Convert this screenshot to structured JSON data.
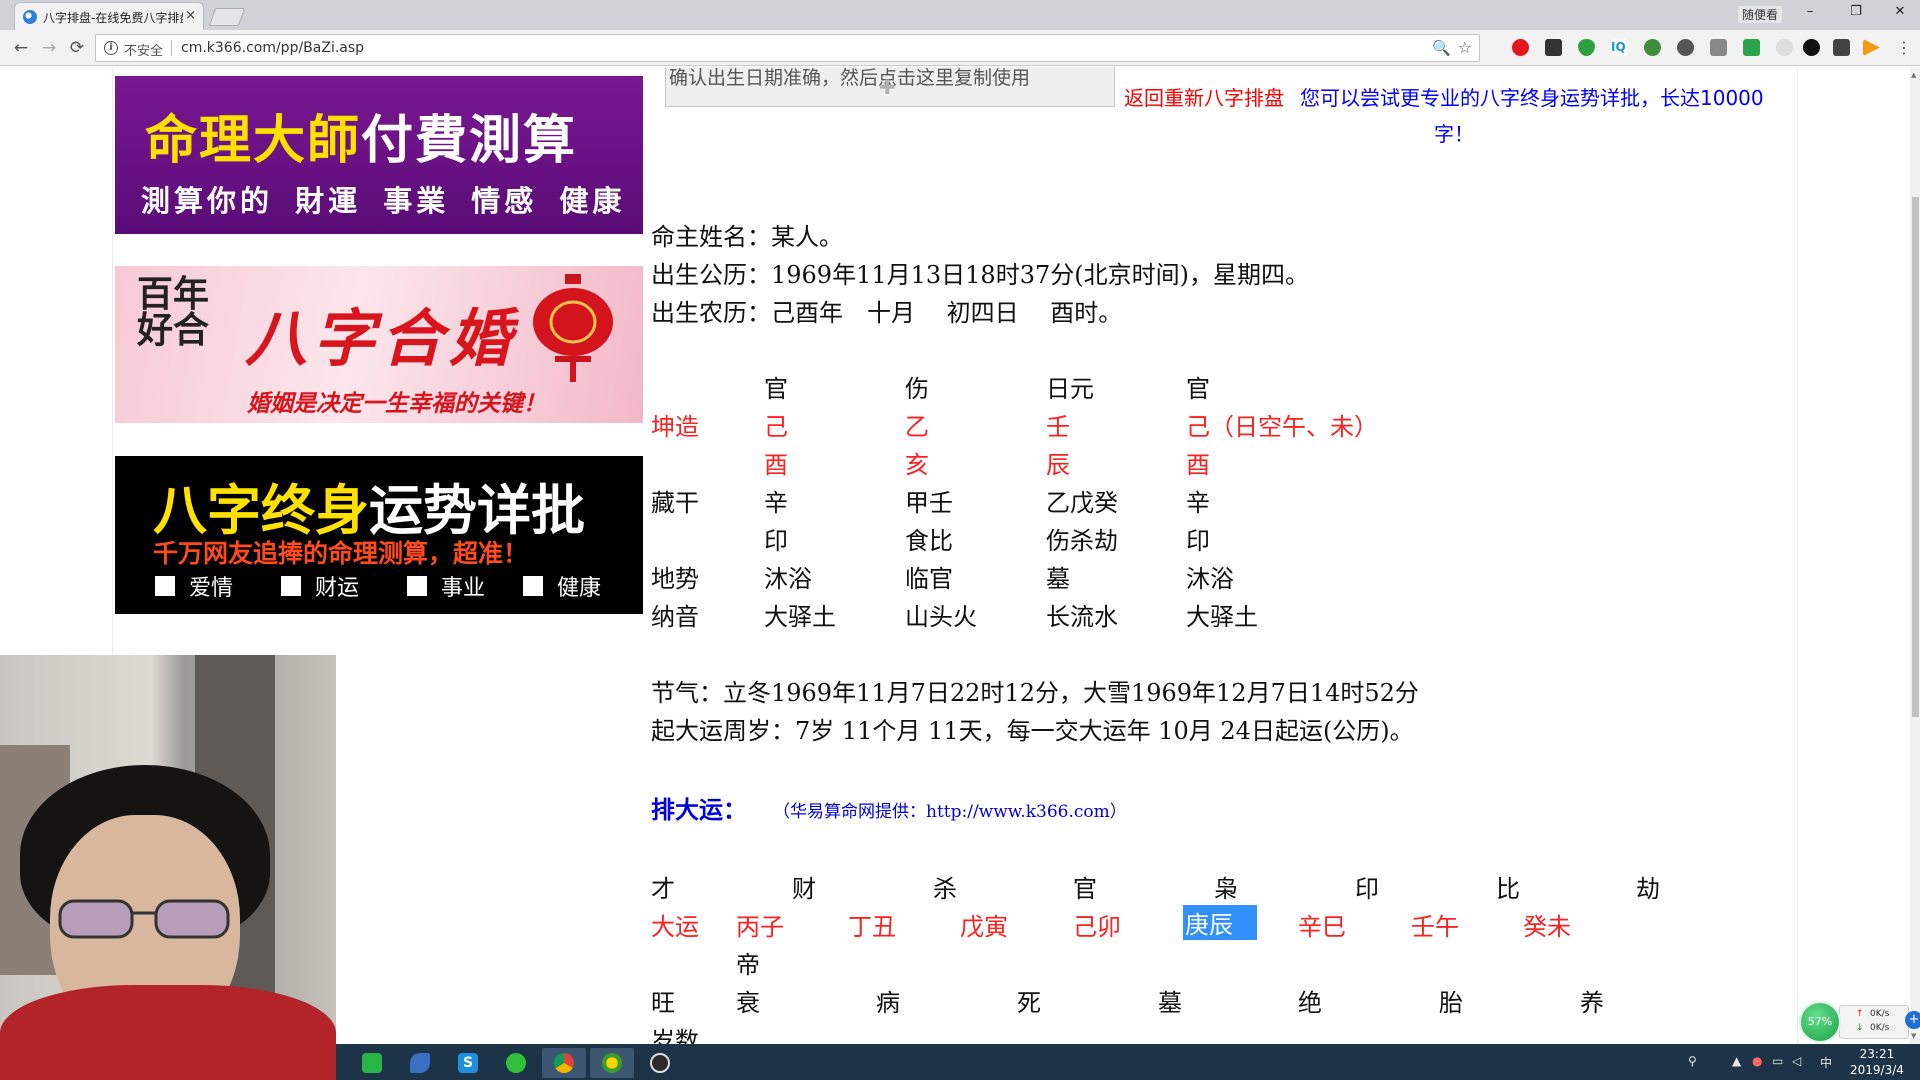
{
  "browser": {
    "tab_title": "八字排盘-在线免费八字排盘",
    "tab_close": "×",
    "user_button": "随便看",
    "win_minimize": "–",
    "win_restore": "❐",
    "win_close": "✕",
    "security_label": "不安全",
    "url": "cm.k366.com/pp/BaZi.asp",
    "nav_back": "←",
    "nav_forward": "→",
    "nav_reload": "⟳",
    "zoom_icon": "🔍",
    "star_icon": "☆",
    "extension_icons": [
      "opera-icon",
      "ghost-icon",
      "shield-icon",
      "iq-icon",
      "globe-icon",
      "people-icon",
      "download-icon",
      "adblock-icon",
      "circle-icon",
      "tiktok-icon",
      "box-icon",
      "play-icon"
    ]
  },
  "ads": {
    "banner1_yellow": "命理大師",
    "banner1_white": "付費測算",
    "banner1_sub": "測算你的 財運 事業 情感 健康",
    "banner2_left": "百年好合",
    "banner2_title": "八字合婚",
    "banner2_sub": "婚姻是决定一生幸福的关键！",
    "banner3_yellow": "八字终身",
    "banner3_white": "运势详批",
    "banner3_sub": "千万网友追捧的命理测算，超准！",
    "banner3_checks": [
      "爱情",
      "财运",
      "事业",
      "健康"
    ]
  },
  "main": {
    "top_caption": "确认出生日期准确，然后点击这里复制使用",
    "rebuild_link": "返回重新八字排盘",
    "promo_link_line1": "您可以尝试更专业的八字终身运势详批，长达10000",
    "promo_link_line2": "字！",
    "name_line": "命主姓名：某人。",
    "solar_line": "出生公历：1969年11月13日18时37分(北京时间)，星期四。",
    "lunar_line": "出生农历：己酉年　十月　 初四日　 酉时。",
    "pillars": {
      "header": [
        "官",
        "伤",
        "日元",
        "官"
      ],
      "row_label": "坤造",
      "stems": [
        "己",
        "乙",
        "壬",
        "己（日空午、未）"
      ],
      "branches": [
        "酉",
        "亥",
        "辰",
        "酉"
      ],
      "hidden_label": "藏干",
      "hidden": [
        "辛",
        "甲壬",
        "乙戊癸",
        "辛"
      ],
      "hidden_gods": [
        "印",
        "食比",
        "伤杀劫",
        "印"
      ],
      "terrain_label": "地势",
      "terrain": [
        "沐浴",
        "临官",
        "墓",
        "沐浴"
      ],
      "nayin_label": "纳音",
      "nayin": [
        "大驿土",
        "山头火",
        "长流水",
        "大驿土"
      ]
    },
    "jieqi_line": "节气：立冬1969年11月7日22时12分，大雪1969年12月7日14时52分",
    "qiyun_line": "起大运周岁：7岁 11个月 11天，每一交大运年 10月 24日起运(公历)。",
    "dayun_title": "排大运：",
    "dayun_source": "（华易算命网提供：http://www.k366.com）",
    "dayun_gods": [
      "才",
      "财",
      "杀",
      "官",
      "枭",
      "印",
      "比",
      "劫"
    ],
    "dayun_label": "大运",
    "dayun_pillars": [
      "丙子",
      "丁丑",
      "戊寅",
      "己卯",
      "庚辰",
      "辛巳",
      "壬午",
      "癸未"
    ],
    "dayun_di": "帝",
    "dayun_states": [
      "旺",
      "衰",
      "病",
      "死",
      "墓",
      "绝",
      "胎",
      "养"
    ],
    "dayun_age_label": "岁数"
  },
  "netmeter": {
    "percent": "57%",
    "up": "0K/s",
    "down": "0K/s",
    "plus": "+"
  },
  "taskbar": {
    "time": "23:21",
    "date": "2019/3/4",
    "ime": "中",
    "tray_icons": [
      "person-icon",
      "arrow-up-icon",
      "qq-icon",
      "network-icon",
      "volume-icon"
    ],
    "apps": [
      "phone-app-icon",
      "bird-app-icon",
      "s-app-icon",
      "wechat-icon",
      "chrome-icon",
      "ball-app-icon",
      "obs-icon"
    ]
  }
}
